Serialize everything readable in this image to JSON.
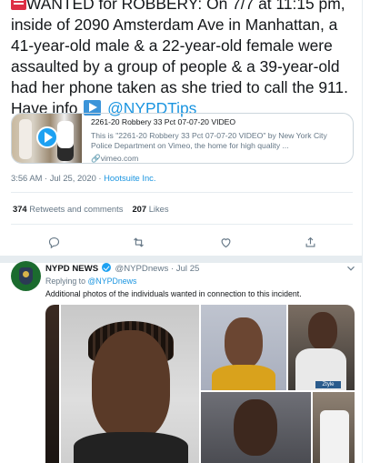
{
  "tweet": {
    "text_pre": "WANTED for ROBBERY: On 7/7 at 11:15 pm, inside of 2090 Amsterdam Ave in Manhattan, a 41-year-old male & a 22-year-old female were assaulted by a group of people & a 39-year-old had her phone taken as she tried to call the 911. Have info",
    "handle_link": "@NYPDTips",
    "card": {
      "title": "2261-20 Robbery 33 Pct 07-07-20 VIDEO",
      "description": "This is \"2261-20 Robbery 33 Pct 07-07-20 VIDEO\" by New York City Police Department on Vimeo, the home for high quality ...",
      "domain": "vimeo.com"
    },
    "timestamp": "3:56 AM · Jul 25, 2020",
    "separator": " · ",
    "source": "Hootsuite Inc.",
    "stats": {
      "retweets_count": "374",
      "retweets_label": "Retweets and comments",
      "likes_count": "207",
      "likes_label": "Likes"
    },
    "actions": {
      "reply_icon": "reply-icon",
      "retweet_icon": "retweet-icon",
      "like_icon": "heart-icon",
      "share_icon": "share-icon"
    }
  },
  "reply": {
    "display_name": "NYPD NEWS",
    "handle": "@NYPDnews",
    "date": "Jul 25",
    "dot": "·",
    "replying_prefix": "Replying to",
    "replying_handle": "@NYPDnews",
    "text": "Additional photos of the individuals wanted in connection to this incident.",
    "photo_tag": "Ztyle clippers"
  },
  "colors": {
    "link": "#1b95e0",
    "muted": "#657786",
    "text": "#14171a",
    "border": "#e6ecf0",
    "verified": "#1da1f2"
  }
}
